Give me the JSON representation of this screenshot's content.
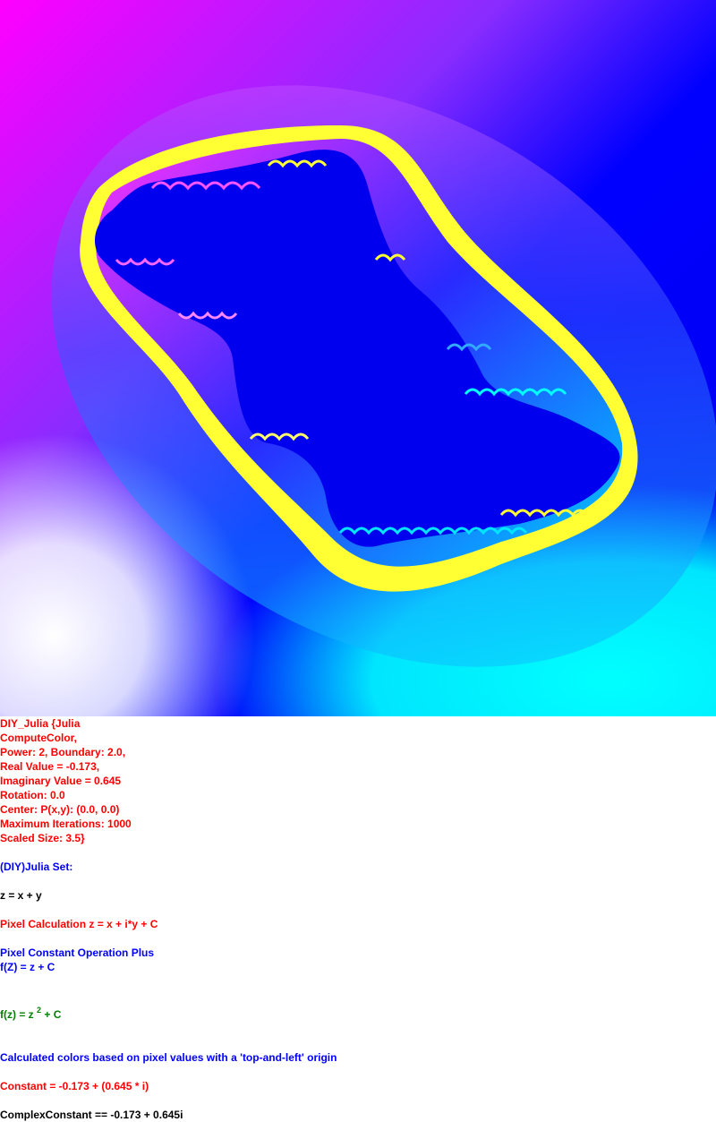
{
  "colors": {
    "red": "#ff0000",
    "blue": "#0000ff",
    "black": "#000000",
    "green": "#008000",
    "fractal_magenta": "#ff00ff",
    "fractal_blue": "#0000ff",
    "fractal_cyan": "#00ffff",
    "fractal_yellow": "#ffff33",
    "fractal_white": "#ffffff"
  },
  "params": {
    "line1": "DIY_Julia {Julia",
    "line2": "ComputeColor,",
    "line3": "Power: 2, Boundary: 2.0,",
    "line4": "Real Value = -0.173,",
    "line5": "Imaginary Value = 0.645",
    "line6": "Rotation: 0.0",
    "line7": "Center: P(x,y): (0.0, 0.0)",
    "line8": "Maximum Iterations: 1000",
    "line9": "Scaled Size: 3.5}"
  },
  "set_title": "(DIY)Julia Set:",
  "z_def": "z = x + y",
  "pixel_calc": "Pixel Calculation z = x + i*y + C",
  "pixel_const_op": "Pixel Constant Operation Plus",
  "fz_plus": "f(Z) = z + C",
  "formula": {
    "prefix": "f(z) = z ",
    "exponent": "2",
    "suffix": " + C"
  },
  "calc_colors": "Calculated colors based on pixel values with a 'top-and-left' origin",
  "constant": "Constant = -0.173 + (0.645 * i)",
  "complex_constant": "ComplexConstant == -0.173 + 0.645i"
}
